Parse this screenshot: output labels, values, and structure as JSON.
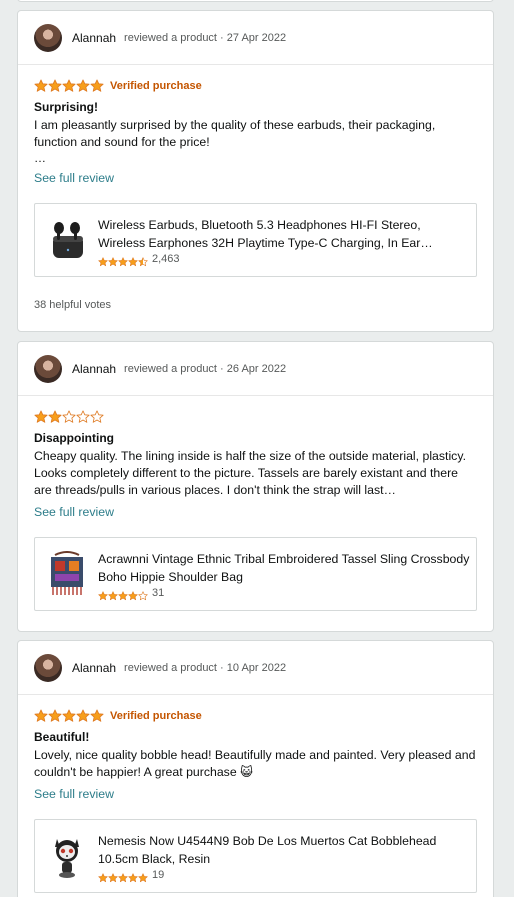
{
  "colors": {
    "accent_star": "#f79e1b",
    "verified": "#c45500",
    "link": "#2d7d8a"
  },
  "reviews": [
    {
      "reviewer": "Alannah",
      "meta": "reviewed a product · 27 Apr 2022",
      "rating": 5,
      "verified": "Verified purchase",
      "title": "Surprising!",
      "text": "I am pleasantly surprised by the quality of these earbuds, their packaging, function and sound for the price!",
      "ellipsis": "…",
      "see_full": "See full review",
      "product": {
        "name": "Wireless Earbuds, Bluetooth 5.3 Headphones HI-FI Stereo, Wireless Earphones 32H Playtime Type-C Charging, In Ear Headphones",
        "rating": 4.5,
        "count": "2,463",
        "icon": "earbuds-icon"
      },
      "helpful": "38 helpful votes"
    },
    {
      "reviewer": "Alannah",
      "meta": "reviewed a product · 26 Apr 2022",
      "rating": 2,
      "title": "Disappointing",
      "text": "Cheapy quality. The lining inside is half the size of the outside material, plasticy. Looks completely different to the picture. Tassels are barely existant and there are threads/pulls in various places. I don't think the strap will last…",
      "see_full": "See full review",
      "product": {
        "name": "Acrawnni Vintage Ethnic Tribal Embroidered Tassel Sling Crossbody Boho Hippie Shoulder Bag",
        "rating": 4,
        "count": "31",
        "icon": "bag-icon"
      }
    },
    {
      "reviewer": "Alannah",
      "meta": "reviewed a product · 10 Apr 2022",
      "rating": 5,
      "verified": "Verified purchase",
      "title": "Beautiful!",
      "text": "Lovely, nice quality bobble head! Beautifully made and painted. Very pleased and couldn't be happier! A great purchase 😺",
      "see_full": "See full review",
      "product": {
        "name": "Nemesis Now U4544N9 Bob De Los Muertos Cat Bobblehead 10.5cm Black, Resin",
        "rating": 5,
        "count": "19",
        "icon": "bobblehead-icon"
      }
    }
  ]
}
